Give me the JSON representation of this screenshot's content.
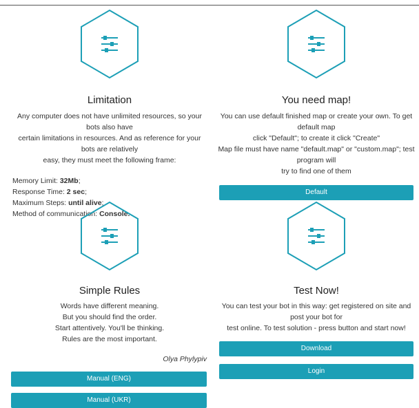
{
  "accent_color": "#1c9fb6",
  "icons": {
    "hex_icon": "sliders-icon"
  },
  "limitation": {
    "title": "Limitation",
    "lines": [
      "Any computer does not have unlimited resources, so your bots also have",
      "certain limitations in resources. And as reference for your bots are relatively",
      "easy, they must meet the following frame:"
    ],
    "specs": [
      {
        "label": "Memory Limit: ",
        "value": "32Mb",
        "suffix": ";"
      },
      {
        "label": "Response Time: ",
        "value": "2 sec",
        "suffix": ";"
      },
      {
        "label": "Maximum Steps: ",
        "value": "until alive",
        "suffix": ";"
      },
      {
        "label": "Method of communication: ",
        "value": "Console.",
        "suffix": ""
      }
    ]
  },
  "map": {
    "title": "You need map!",
    "lines": [
      "You can use default finished map or create your own. To get default map",
      "click \"Default\"; to create it click \"Create\"",
      "Map file must have name \"default.map\" or \"custom.map\"; test program will",
      "try to find one of them"
    ],
    "default_label": "Default"
  },
  "rules": {
    "title": "Simple Rules",
    "lines": [
      "Words have different meaning.",
      "But you should find the order.",
      "Start attentively. You'll be thinking.",
      "Rules are the most important."
    ],
    "signature": "Olya Phylypiv",
    "manual_eng_label": "Manual (ENG)",
    "manual_ukr_label": "Manual (UKR)"
  },
  "test": {
    "title": "Test Now!",
    "lines": [
      "You can test your bot in this way: get registered on site and post your bot for",
      "test online. To test solution - press button and start now!"
    ],
    "download_label": "Download",
    "login_label": "Login"
  }
}
